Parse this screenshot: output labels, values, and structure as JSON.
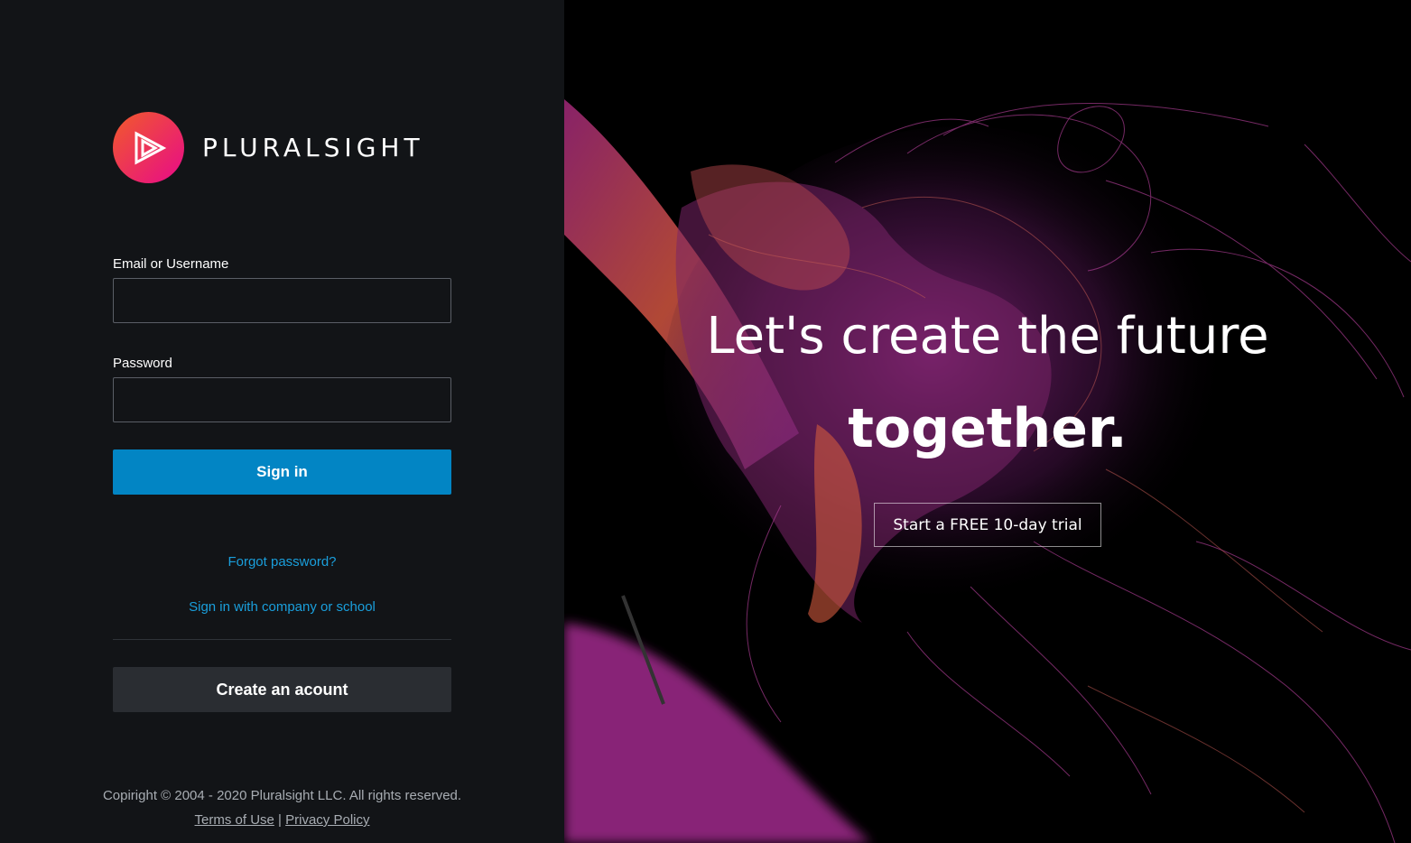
{
  "brand": {
    "name": "PLURALSIGHT",
    "logo_icon": "pluralsight-play-icon",
    "gradient_start": "#f15b2a",
    "gradient_end": "#e80a89"
  },
  "form": {
    "email_label": "Email or Username",
    "email_value": "",
    "password_label": "Password",
    "password_value": "",
    "signin_label": "Sign in",
    "signin_color": "#0285c4"
  },
  "links": {
    "forgot_password": "Forgot password?",
    "company_signin": "Sign in with company or school",
    "link_color": "#1a9fdc"
  },
  "create_account": {
    "label": "Create an acount"
  },
  "footer": {
    "copyright": "Copiright © 2004 - 2020 Pluralsight LLC. All rights reserved.",
    "terms": "Terms of Use",
    "separator": "|",
    "privacy": "Privacy Policy"
  },
  "hero": {
    "headline_line1": "Let's create the future",
    "headline_line2": "together.",
    "trial_button": "Start a FREE 10-day trial"
  }
}
